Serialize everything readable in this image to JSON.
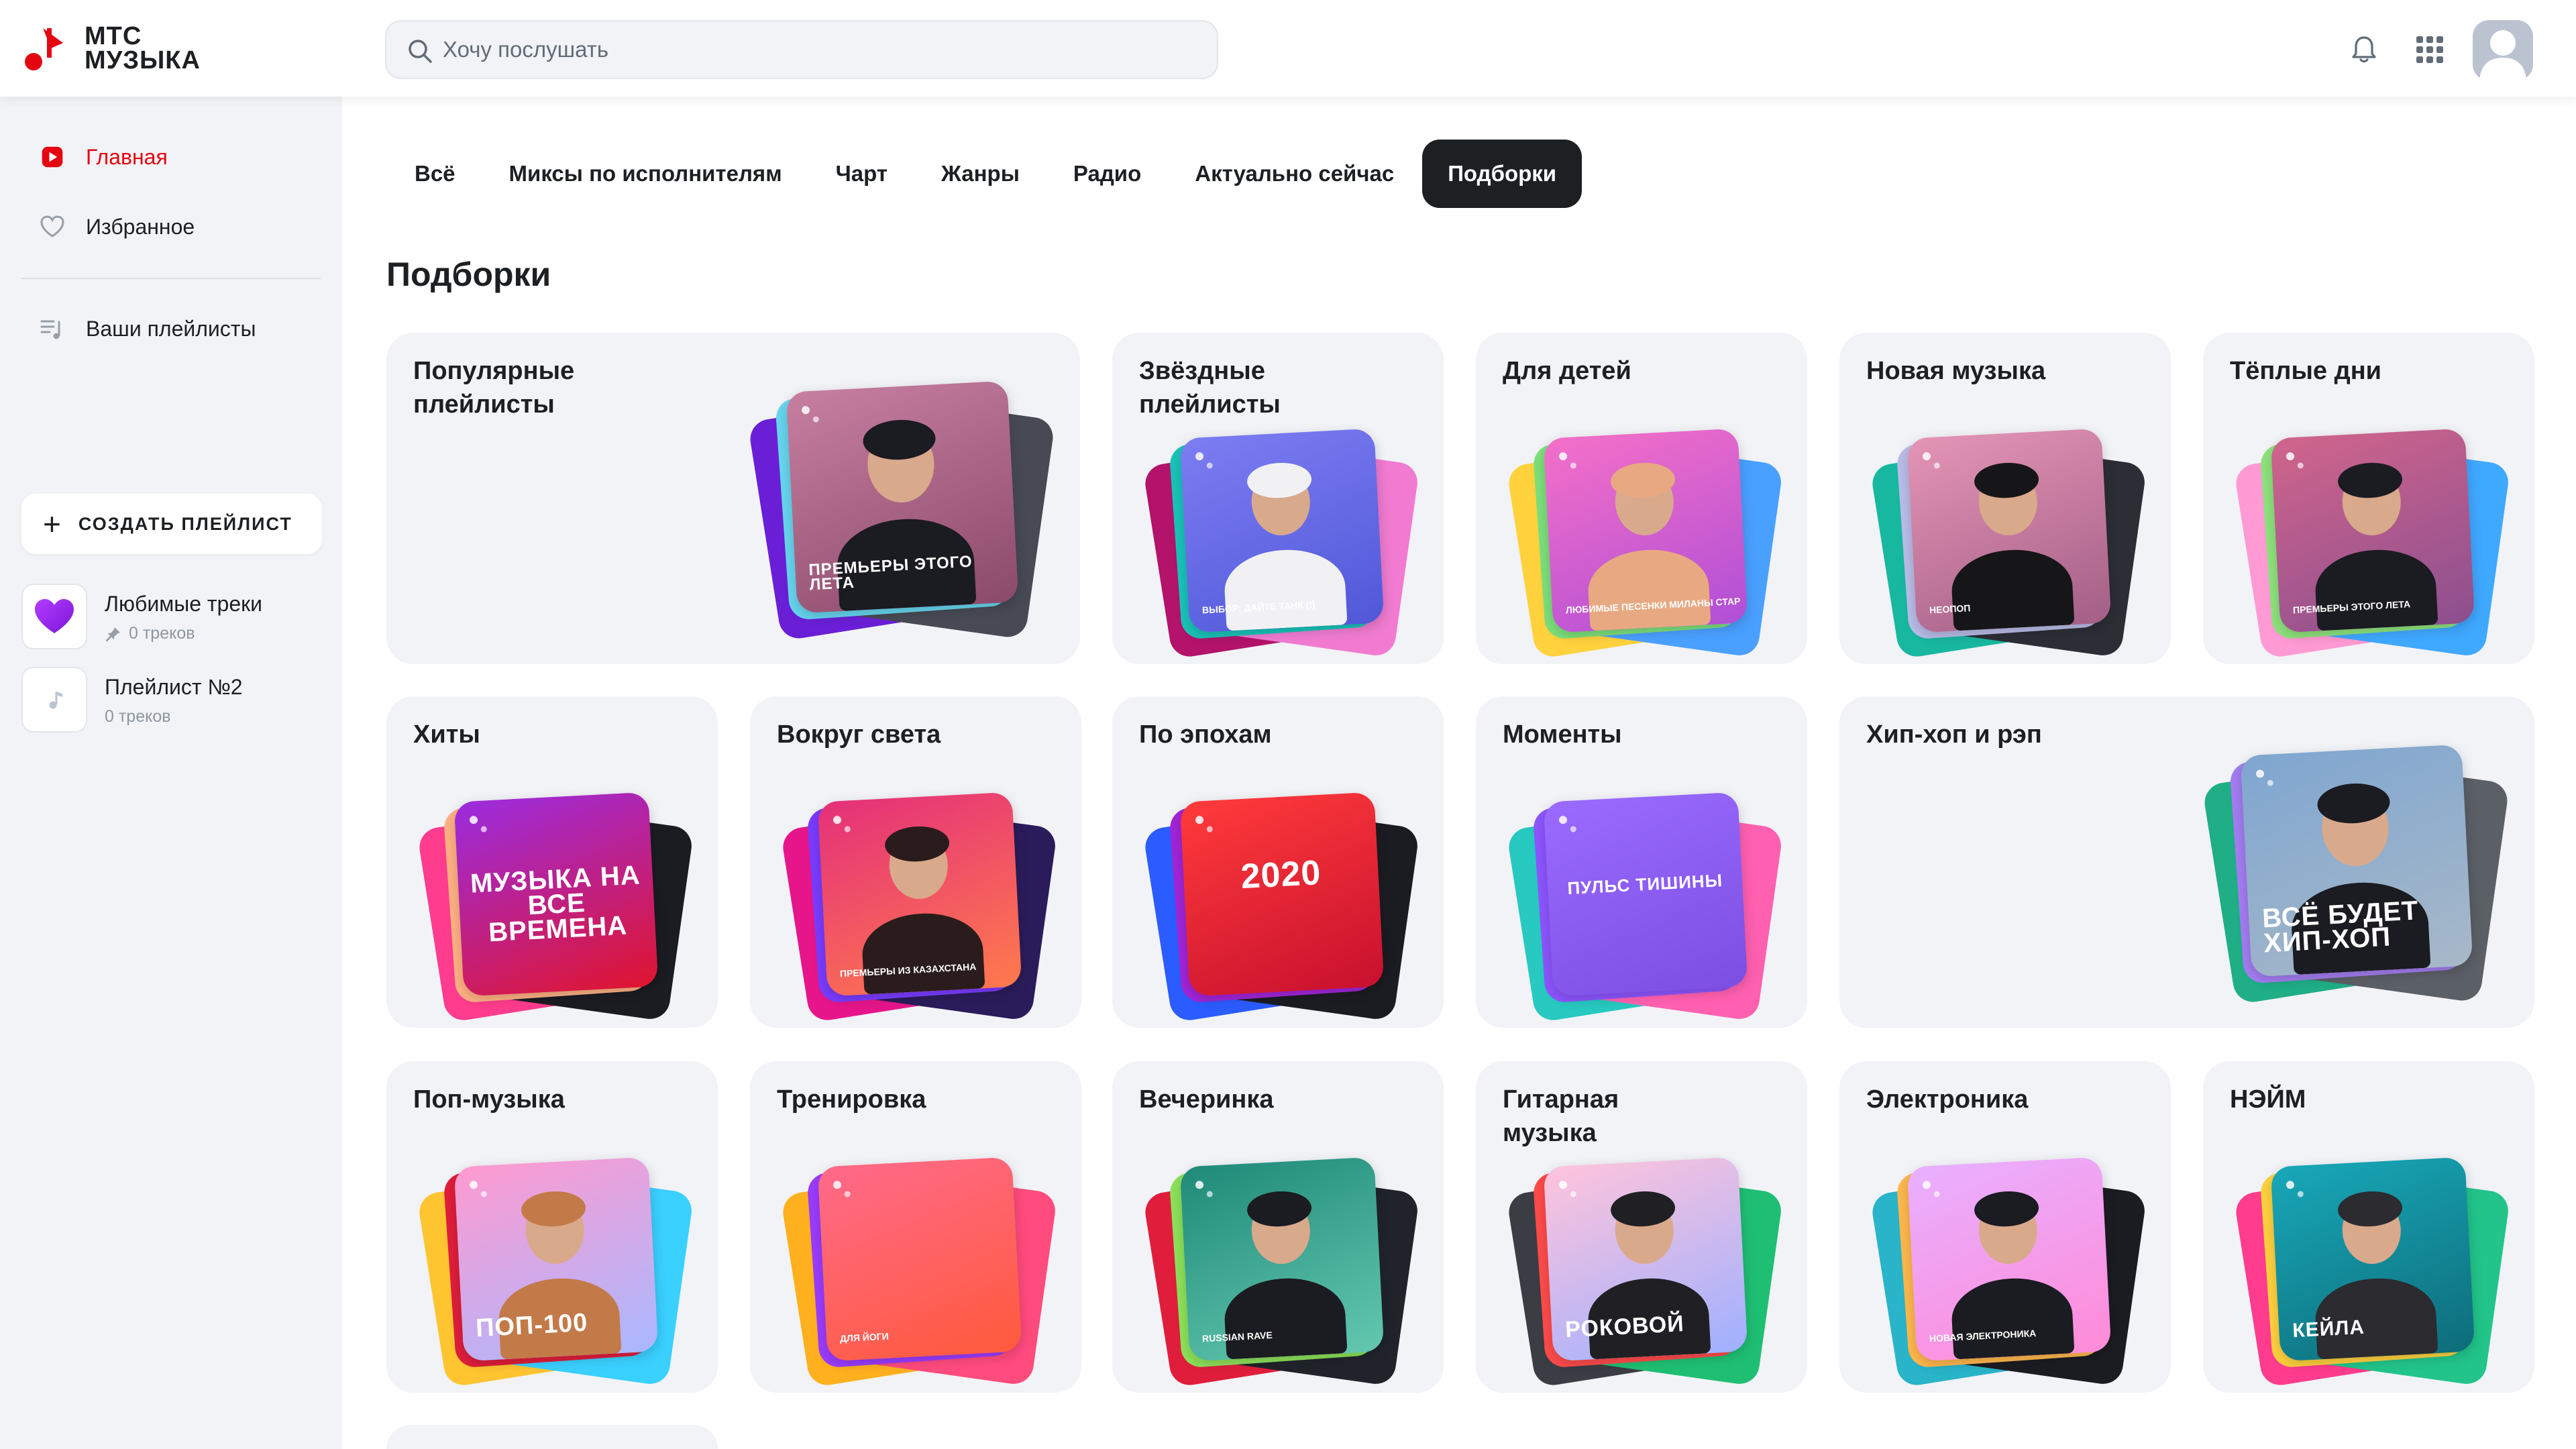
{
  "header": {
    "logo_text": "МТС\nМУЗЫКА",
    "search_placeholder": "Хочу послушать"
  },
  "sidebar": {
    "nav": [
      {
        "label": "Главная",
        "active": true
      },
      {
        "label": "Избранное",
        "active": false
      },
      {
        "label": "Ваши плейлисты",
        "active": false
      }
    ],
    "create_label": "СОЗДАТЬ ПЛЕЙЛИСТ",
    "playlists": [
      {
        "title": "Любимые треки",
        "subtitle": "0 треков",
        "pinned": true
      },
      {
        "title": "Плейлист №2",
        "subtitle": "0 треков",
        "pinned": false
      }
    ]
  },
  "tabs": [
    {
      "label": "Всё",
      "active": false
    },
    {
      "label": "Миксы по исполнителям",
      "active": false
    },
    {
      "label": "Чарт",
      "active": false
    },
    {
      "label": "Жанры",
      "active": false
    },
    {
      "label": "Радио",
      "active": false
    },
    {
      "label": "Актуально сейчас",
      "active": false
    },
    {
      "label": "Подборки",
      "active": true
    }
  ],
  "section_title": "Подборки",
  "cards": [
    {
      "title": "Популярные плейлисты",
      "cover_text": "ПРЕМЬЕРЫ ЭТОГО ЛЕТА"
    },
    {
      "title": "Звёздные плейлисты",
      "cover_text": "ВЫБОР: ДАЙТЕ ТАНК (!)"
    },
    {
      "title": "Для детей",
      "cover_text": "ЛЮБИМЫЕ ПЕСЕНКИ МИЛАНЫ СТАР"
    },
    {
      "title": "Новая музыка",
      "cover_text": "НЕОПОП"
    },
    {
      "title": "Тёплые дни",
      "cover_text": "ПРЕМЬЕРЫ ЭТОГО ЛЕТА"
    },
    {
      "title": "Хиты",
      "cover_text": "МУЗЫКА НА ВСЕ ВРЕМЕНА"
    },
    {
      "title": "Вокруг света",
      "cover_text": "ПРЕМЬЕРЫ ИЗ КАЗАХСТАНА"
    },
    {
      "title": "По эпохам",
      "cover_text": "2020"
    },
    {
      "title": "Моменты",
      "cover_text": "ПУЛЬС ТИШИНЫ"
    },
    {
      "title": "Хип-хоп и рэп",
      "cover_text": "ВСЁ БУДЕТ ХИП-ХОП"
    },
    {
      "title": "Поп-музыка",
      "cover_text": "ПОП-100"
    },
    {
      "title": "Тренировка",
      "cover_text": "ДЛЯ ЙОГИ"
    },
    {
      "title": "Вечеринка",
      "cover_text": "RUSSIAN RAVE"
    },
    {
      "title": "Гитарная музыка",
      "cover_text": "РОКОВОЙ"
    },
    {
      "title": "Электроника",
      "cover_text": "НОВАЯ ЭЛЕКТРОНИКА"
    },
    {
      "title": "НЭЙМ",
      "cover_text": "КЕЙЛА"
    }
  ],
  "colors": {
    "accent": "#e30611",
    "sidebar_bg": "#f2f3f7",
    "card_bg": "#f2f3f7",
    "active_tab_bg": "#1d2023"
  }
}
